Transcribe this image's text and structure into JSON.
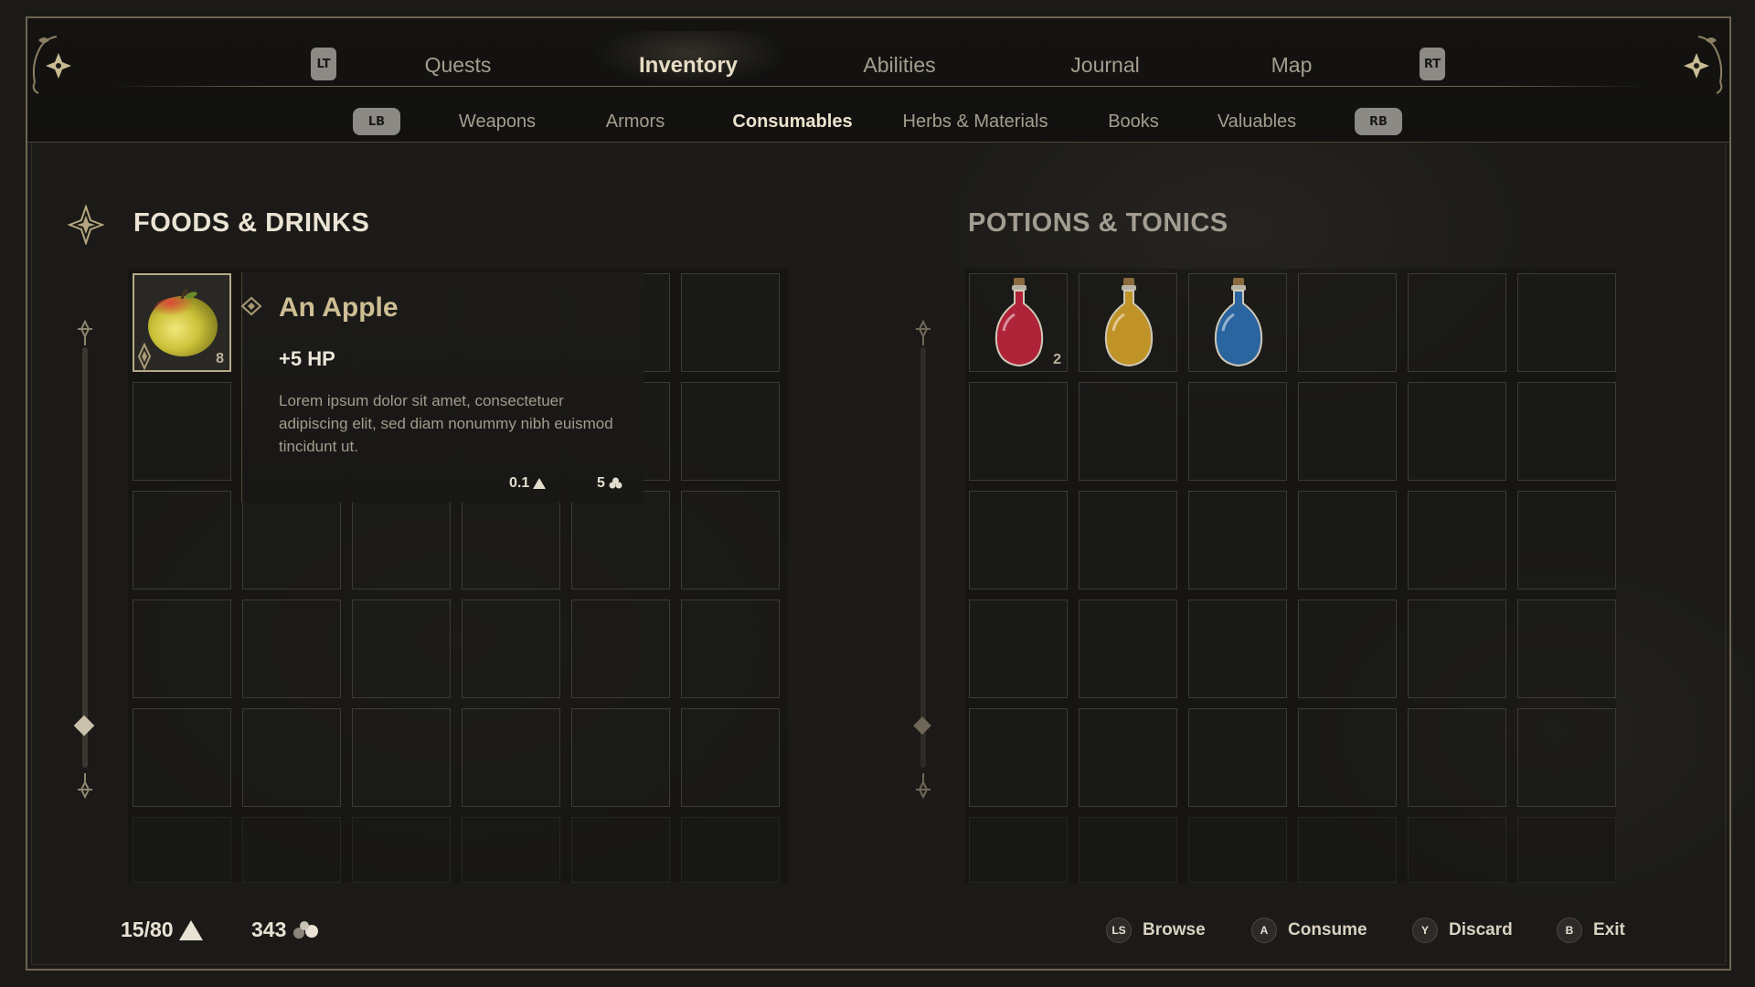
{
  "nav": {
    "left_bumper": "LT",
    "right_bumper": "RT",
    "tabs": [
      {
        "label": "Quests",
        "active": false
      },
      {
        "label": "Inventory",
        "active": true
      },
      {
        "label": "Abilities",
        "active": false
      },
      {
        "label": "Journal",
        "active": false
      },
      {
        "label": "Map",
        "active": false
      }
    ]
  },
  "subnav": {
    "left_bumper": "LB",
    "right_bumper": "RB",
    "tabs": [
      {
        "label": "Weapons",
        "active": false
      },
      {
        "label": "Armors",
        "active": false
      },
      {
        "label": "Consumables",
        "active": true
      },
      {
        "label": "Herbs & Materials",
        "active": false
      },
      {
        "label": "Books",
        "active": false
      },
      {
        "label": "Valuables",
        "active": false
      }
    ]
  },
  "foods": {
    "title": "FOODS & DRINKS",
    "items": [
      {
        "name": "apple",
        "count": "8",
        "selected": true
      }
    ]
  },
  "potions": {
    "title": "POTIONS & TONICS",
    "items": [
      {
        "name": "red-potion",
        "count": "2",
        "color": "#b8243a"
      },
      {
        "name": "yellow-potion",
        "count": "",
        "color": "#c99a2a"
      },
      {
        "name": "blue-potion",
        "count": "",
        "color": "#2c6aa8"
      }
    ]
  },
  "tooltip": {
    "name": "An Apple",
    "stat": "+5 HP",
    "description": "Lorem ipsum dolor sit amet, consectetuer adipiscing elit, sed diam nonummy nibh euismod tincidunt ut.",
    "weight": "0.1",
    "value": "5"
  },
  "footer": {
    "weight": "15/80",
    "coins": "343",
    "prompts": [
      {
        "button": "LS",
        "label": "Browse"
      },
      {
        "button": "A",
        "label": "Consume"
      },
      {
        "button": "Y",
        "label": "Discard"
      },
      {
        "button": "B",
        "label": "Exit"
      }
    ]
  },
  "colors": {
    "accent_gold": "#cdbe93",
    "frame": "#6e6452",
    "background": "#1b1a18"
  }
}
